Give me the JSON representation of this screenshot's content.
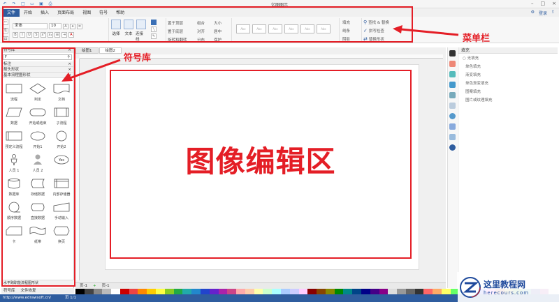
{
  "window": {
    "title": "亿图图示"
  },
  "menu": {
    "tabs": [
      "文件",
      "开始",
      "插入",
      "页面布局",
      "视图",
      "符号",
      "帮助"
    ],
    "active": "文件",
    "right": [
      "登录"
    ]
  },
  "ribbon": {
    "font_name": "宋体",
    "font_size": "10",
    "tools": {
      "select": "选择",
      "text": "文本",
      "connector": "连接线"
    },
    "arrange": [
      "置于顶层",
      "置于底层",
      "旋转和翻转",
      "组合",
      "对齐",
      "分布",
      "大小",
      "居中",
      "保护"
    ],
    "fill_items": [
      "填充",
      "线条",
      "阴影"
    ],
    "find": [
      "查找 & 替换",
      "拼写检查",
      "替换形状"
    ]
  },
  "library": {
    "title": "符号库",
    "search_value": "F",
    "categories": [
      "标注",
      "箭头形状",
      "基本流程图形状"
    ],
    "shapes": [
      "流程",
      "判定",
      "文档",
      "数据",
      "开始或结束",
      "子流程",
      "预定义流程",
      "开始1",
      "开始2",
      "人员 1",
      "人员 2",
      "Yes",
      "数据库",
      "存储数据",
      "内部存储器",
      "顺序数据",
      "直接数据",
      "手动输入",
      "卡",
      "纸带",
      "换页"
    ],
    "footer": "水平跨职能流程图形状",
    "bottom_tabs": [
      "符号库",
      "文件恢复"
    ]
  },
  "documents": {
    "tabs": [
      "绘图1",
      "绘图2"
    ],
    "active": "绘图2",
    "page_tabs": [
      "页-1",
      "页-1"
    ]
  },
  "canvas": {
    "label": "图像编辑区"
  },
  "fill_panel": {
    "title": "填充",
    "options": [
      "无填充",
      "单色填充",
      "渐变填充",
      "单色渐变填充",
      "图案填充",
      "图片或纹理填充"
    ]
  },
  "annotations": {
    "menubar": "菜单栏",
    "library": "符号库"
  },
  "status": {
    "url": "http://www.edrawsoft.cn/",
    "page": "页 1/1"
  },
  "watermark": {
    "name": "这里教程网",
    "url": "herecours.com"
  },
  "colors": {
    "accent": "#2f5d9f",
    "annotation": "#e41e26"
  }
}
